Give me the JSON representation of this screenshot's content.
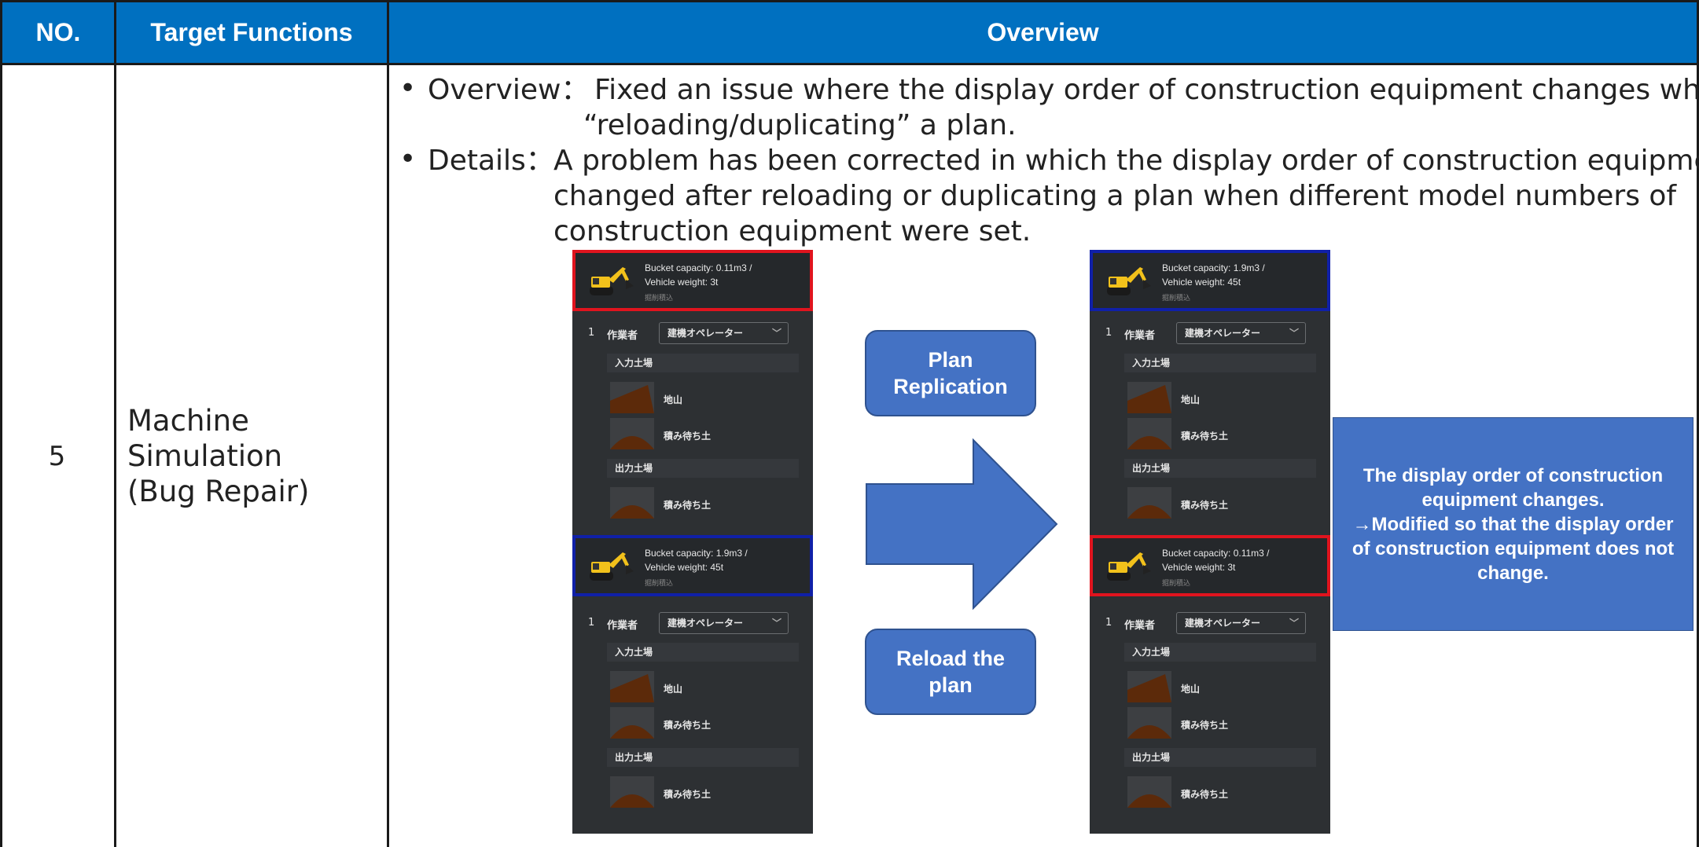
{
  "header": {
    "no": "NO.",
    "functions": "Target Functions",
    "overview": "Overview"
  },
  "row": {
    "no": "5",
    "function": "Machine\nSimulation\n(Bug Repair)"
  },
  "overview": {
    "bullet": "•",
    "overview_label": "Overview：",
    "overview_line1": "Fixed an issue where the display order of construction equipment changes when",
    "overview_line2": "“reloading/duplicating” a plan.",
    "details_label": "Details：",
    "details_line1": "A problem has been corrected in which the display order of construction equipment",
    "details_line2": "changed after reloading or duplicating a plan when different model numbers of",
    "details_line3": "construction equipment were set."
  },
  "left_panel": {
    "eq1": {
      "cap1": "Bucket capacity: 0.11m3 /",
      "cap2": "Vehicle weight: 3t",
      "sub": "掘削積込"
    },
    "eq2": {
      "cap1": "Bucket capacity: 1.9m3 /",
      "cap2": "Vehicle weight: 45t",
      "sub": "掘削積込"
    }
  },
  "right_panel": {
    "eq1": {
      "cap1": "Bucket capacity: 1.9m3 /",
      "cap2": "Vehicle weight: 45t",
      "sub": "掘削積込"
    },
    "eq2": {
      "cap1": "Bucket capacity: 0.11m3 /",
      "cap2": "Vehicle weight: 3t",
      "sub": "掘削積込"
    }
  },
  "panel_common": {
    "num": "1",
    "worker": "作業者",
    "operator": "建機オペレーター",
    "chev": "﹀",
    "input_field": "入力土場",
    "mound": "地山",
    "waiting_soil": "積み待ち土",
    "output_field": "出力土場"
  },
  "buttons": {
    "plan_replication": "Plan\nReplication",
    "reload_plan": "Reload the\nplan"
  },
  "note": "The display order of construction equipment changes.\n→Modified so that the display order of construction equipment does not change.",
  "colors": {
    "header_bg": "#0070c0",
    "button_bg": "#4472c4",
    "highlight_red": "#e0141e",
    "highlight_blue": "#1020a8",
    "panel_bg": "#2d3033"
  },
  "icons": {
    "excavator": "excavator-icon",
    "soil_mound": "soil-mound-icon",
    "soil_pile": "soil-pile-icon",
    "arrow": "right-arrow-icon"
  }
}
